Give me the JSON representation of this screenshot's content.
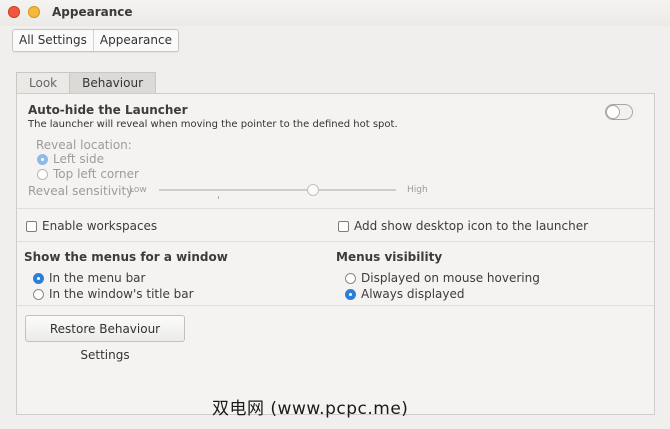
{
  "window": {
    "title": "Appearance"
  },
  "breadcrumbs": [
    "All Settings",
    "Appearance"
  ],
  "tabs": [
    {
      "label": "Look",
      "active": false
    },
    {
      "label": "Behaviour",
      "active": true
    }
  ],
  "launcher": {
    "title": "Auto-hide the Launcher",
    "description": "The launcher will reveal when moving the pointer to the defined hot spot.",
    "toggle_on": false,
    "reveal_location_label": "Reveal location:",
    "reveal_options": [
      {
        "label": "Left side",
        "selected": true
      },
      {
        "label": "Top left corner",
        "selected": false
      }
    ],
    "sensitivity_label": "Reveal sensitivity",
    "sensitivity_low": "Low",
    "sensitivity_high": "High",
    "sensitivity_value": 0.65
  },
  "options": {
    "enable_workspaces": {
      "label": "Enable workspaces",
      "checked": false
    },
    "show_desktop_icon": {
      "label": "Add show desktop icon to the launcher",
      "checked": false
    }
  },
  "menus": {
    "title": "Show the menus for a window",
    "options": [
      {
        "label": "In the menu bar",
        "selected": true
      },
      {
        "label": "In the window's title bar",
        "selected": false
      }
    ]
  },
  "visibility": {
    "title": "Menus visibility",
    "options": [
      {
        "label": "Displayed on mouse hovering",
        "selected": false
      },
      {
        "label": "Always displayed",
        "selected": true
      }
    ]
  },
  "restore_button": "Restore Behaviour Settings",
  "watermark": "双电网 (www.pcpc.me)",
  "colors": {
    "accent": "#2a7fd8",
    "close": "#f1573f",
    "minimize": "#f3b93d"
  }
}
